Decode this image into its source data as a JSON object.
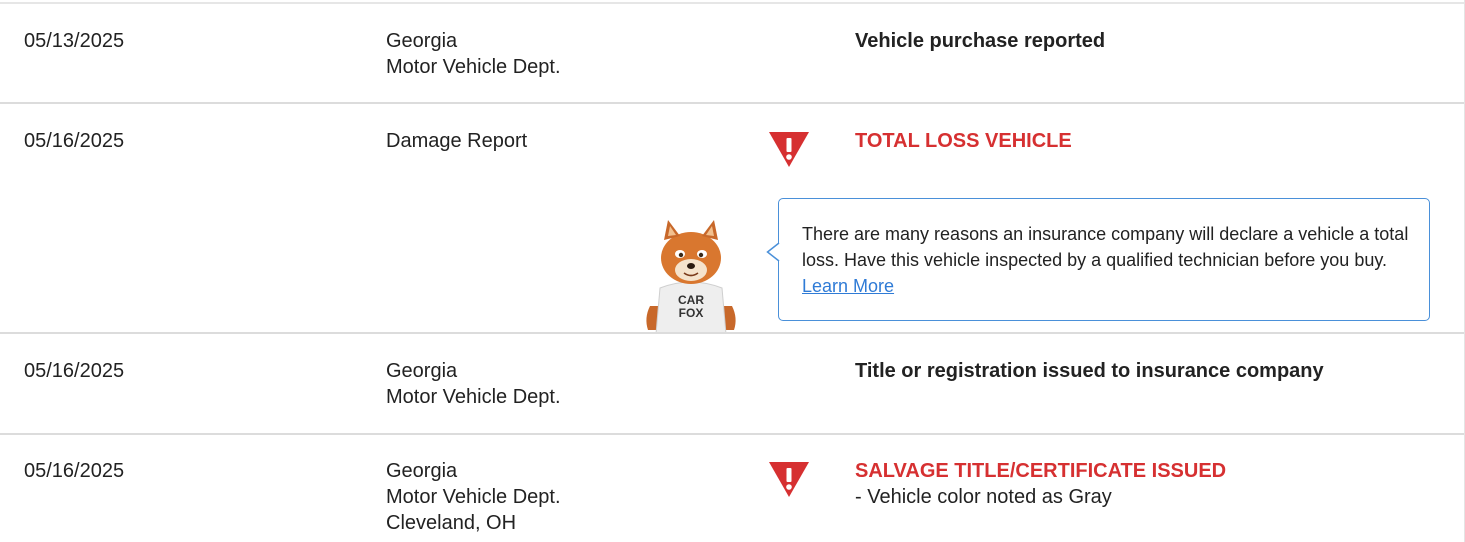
{
  "records": [
    {
      "date": "05/13/2025",
      "source_lines": [
        "Georgia",
        "Motor Vehicle Dept."
      ],
      "headline": "Vehicle purchase reported",
      "alert": false
    },
    {
      "date": "05/16/2025",
      "source_lines": [
        "Damage Report"
      ],
      "headline": "TOTAL LOSS VEHICLE",
      "alert": true
    },
    {
      "date": "05/16/2025",
      "source_lines": [
        "Georgia",
        "Motor Vehicle Dept."
      ],
      "headline": "Title or registration issued to insurance company",
      "alert": false
    },
    {
      "date": "05/16/2025",
      "source_lines": [
        "Georgia",
        "Motor Vehicle Dept.",
        "Cleveland, OH"
      ],
      "headline": "SALVAGE TITLE/CERTIFICATE ISSUED",
      "detail": "- Vehicle color noted as Gray",
      "alert": true
    }
  ],
  "callout": {
    "text": "There are many reasons an insurance company will declare a vehicle a total loss. Have this vehicle inspected by a qualified technician before you buy.",
    "link_label": "Learn More"
  },
  "mascot": {
    "shirt_line1": "CAR",
    "shirt_line2": "FOX"
  },
  "icons": {
    "alert": "warning-triangle-icon",
    "mascot": "carfox-mascot-icon"
  },
  "colors": {
    "alert_red": "#d63031",
    "link_blue": "#2f7bd6",
    "callout_border": "#4a90d9",
    "divider": "#dcdcdc"
  }
}
